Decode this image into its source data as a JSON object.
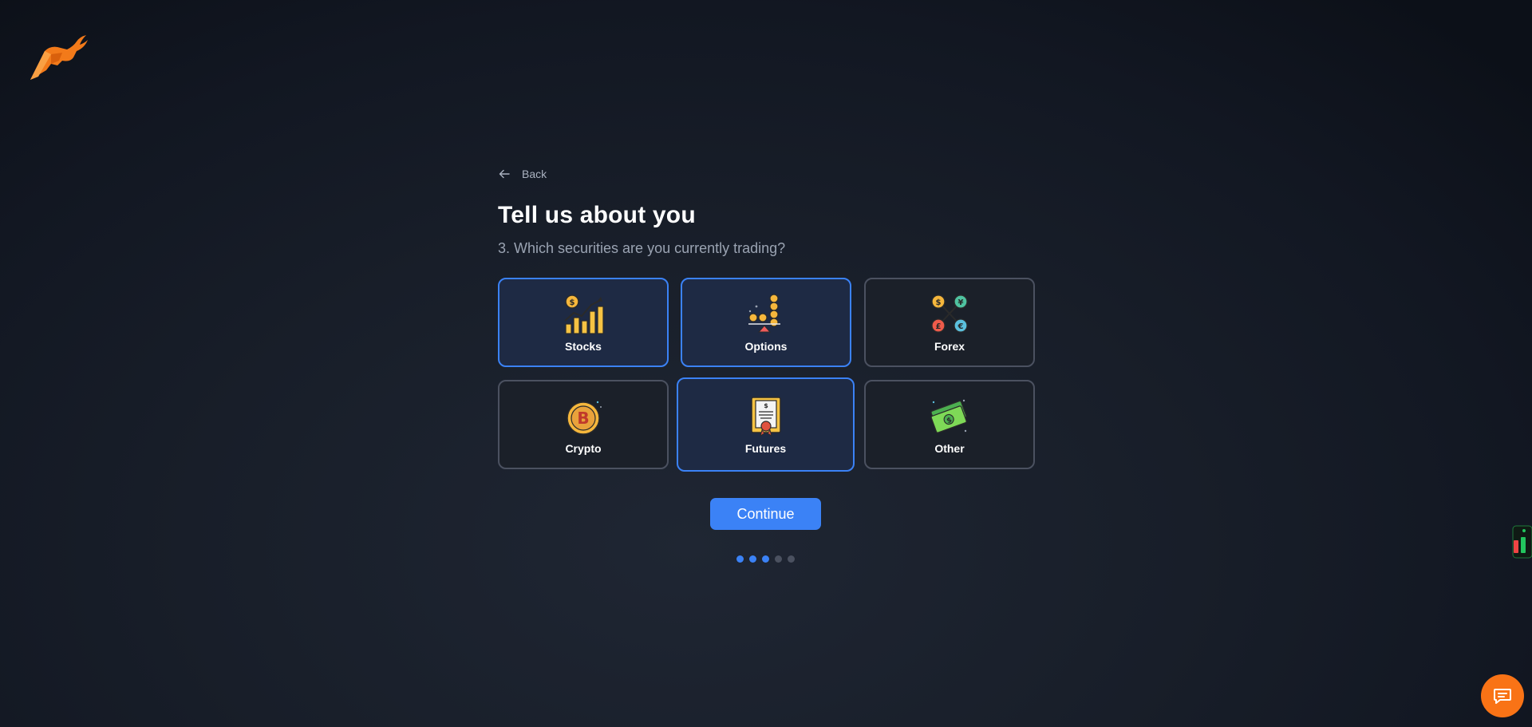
{
  "brand": {
    "logo_icon": "bull-logo-icon",
    "accent_color": "#f97316"
  },
  "back": {
    "label": "Back",
    "icon": "arrow-left-icon"
  },
  "page": {
    "title": "Tell us about you",
    "question": "3. Which securities are you currently trading?"
  },
  "options": [
    {
      "label": "Stocks",
      "icon": "stocks-chart-icon",
      "selected": true
    },
    {
      "label": "Options",
      "icon": "options-coins-icon",
      "selected": true
    },
    {
      "label": "Forex",
      "icon": "forex-currency-icon",
      "selected": false
    },
    {
      "label": "Crypto",
      "icon": "bitcoin-icon",
      "selected": false
    },
    {
      "label": "Futures",
      "icon": "futures-certificate-icon",
      "selected": true
    },
    {
      "label": "Other",
      "icon": "cash-bills-icon",
      "selected": false
    }
  ],
  "continue_label": "Continue",
  "progress": {
    "current_step": 3,
    "total_steps": 5
  },
  "colors": {
    "primary": "#3b82f6",
    "selected_bg": "#1e2a44",
    "card_border": "#4b5160"
  },
  "chat": {
    "icon": "chat-icon"
  },
  "side_widget": {
    "icon": "candlestick-chart-icon"
  }
}
